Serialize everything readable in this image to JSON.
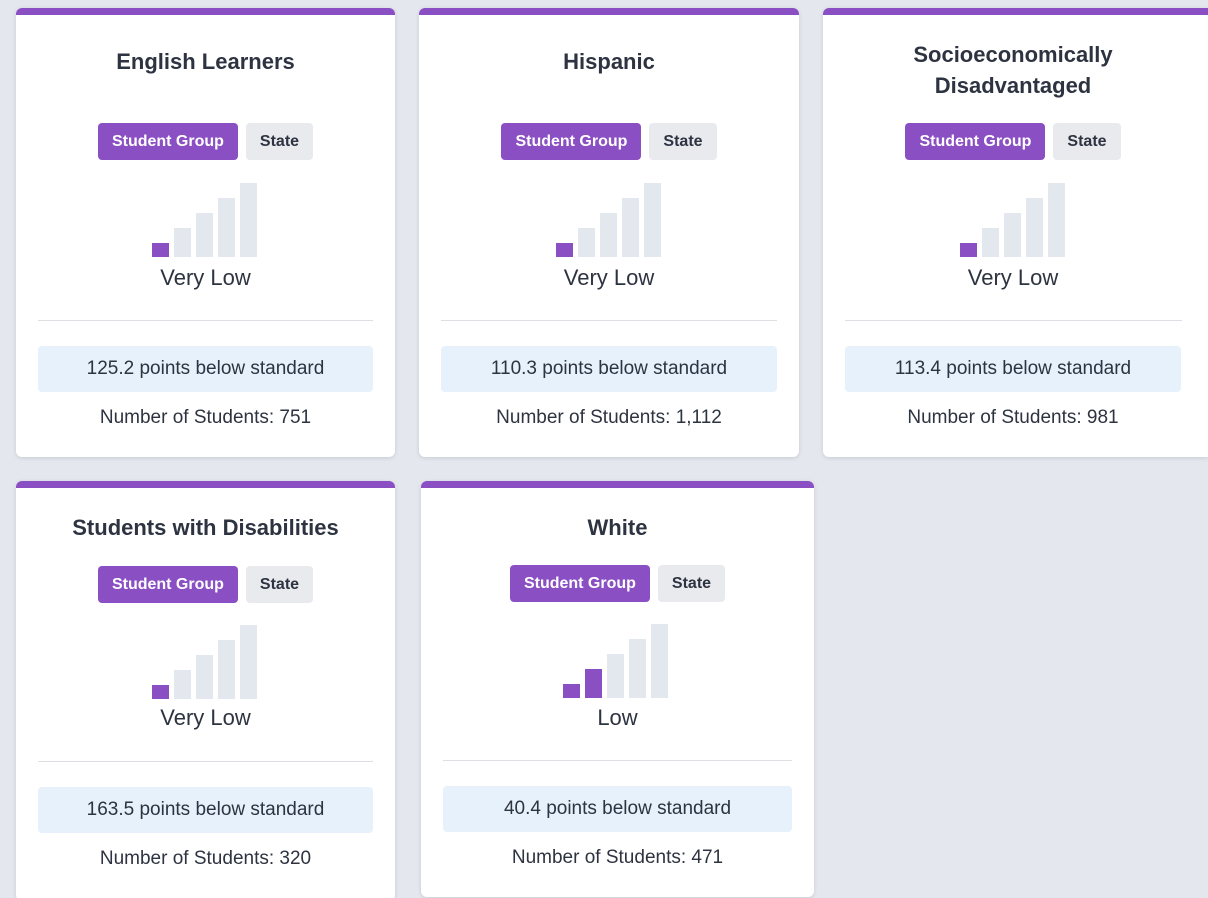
{
  "colors": {
    "accent": "#8b4fc4",
    "bar_inactive": "#e3e7ee",
    "score_bg": "#e6f1fb",
    "page_bg": "#e4e7ee"
  },
  "cards": [
    {
      "title_lines": [
        "English Learners"
      ],
      "badges": {
        "group": "Student Group",
        "state": "State"
      },
      "level_filled": 1,
      "level_total": 5,
      "level_label": "Very Low",
      "score": "125.2 points below standard",
      "count": "Number of Students: 751"
    },
    {
      "title_lines": [
        "Hispanic"
      ],
      "badges": {
        "group": "Student Group",
        "state": "State"
      },
      "level_filled": 1,
      "level_total": 5,
      "level_label": "Very Low",
      "score": "110.3 points below standard",
      "count": "Number of Students: 1,112"
    },
    {
      "title_lines": [
        "Socioeconomically",
        "Disadvantaged"
      ],
      "badges": {
        "group": "Student Group",
        "state": "State"
      },
      "level_filled": 1,
      "level_total": 5,
      "level_label": "Very Low",
      "score": "113.4 points below standard",
      "count": "Number of Students: 981"
    },
    {
      "title_lines": [
        "Students with Disabilities"
      ],
      "badges": {
        "group": "Student Group",
        "state": "State"
      },
      "level_filled": 1,
      "level_total": 5,
      "level_label": "Very Low",
      "score": "163.5 points below standard",
      "count": "Number of Students: 320"
    },
    {
      "title_lines": [
        "White"
      ],
      "badges": {
        "group": "Student Group",
        "state": "State"
      },
      "level_filled": 2,
      "level_total": 5,
      "level_label": "Low",
      "score": "40.4 points below standard",
      "count": "Number of Students: 471"
    }
  ]
}
